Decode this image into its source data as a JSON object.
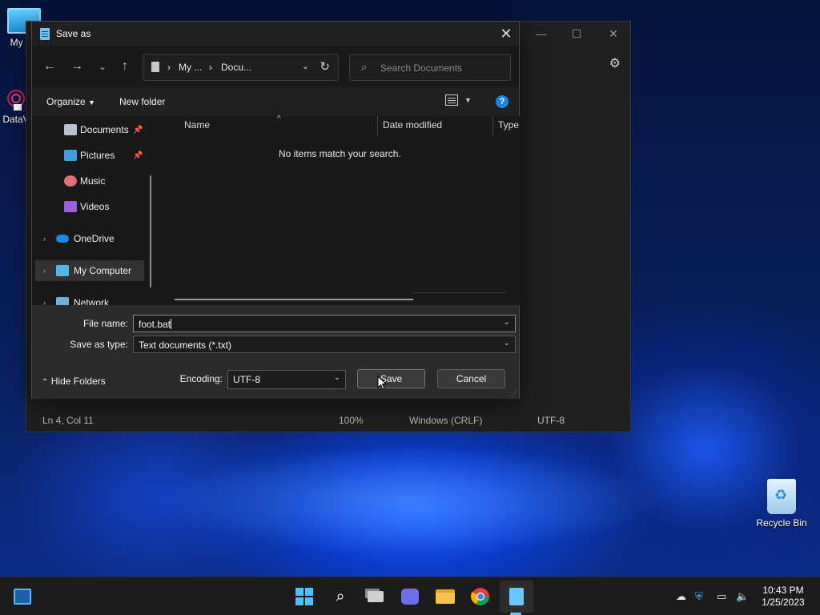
{
  "desktop": {
    "icons": [
      {
        "label": "My Co"
      },
      {
        "label": "DataV"
      },
      {
        "label": "Recycle Bin"
      }
    ]
  },
  "notepad": {
    "status": {
      "position": "Ln 4, Col 11",
      "zoom": "100%",
      "line_endings": "Windows (CRLF)",
      "encoding": "UTF-8"
    }
  },
  "dialog": {
    "title": "Save as",
    "address": {
      "crumb1": "My ...",
      "crumb2": "Docu..."
    },
    "search": {
      "placeholder": "Search Documents"
    },
    "commands": {
      "organize": "Organize",
      "new_folder": "New folder"
    },
    "sidebar": [
      {
        "label": "Documents",
        "pinned": true
      },
      {
        "label": "Pictures",
        "pinned": true
      },
      {
        "label": "Music"
      },
      {
        "label": "Videos"
      },
      {
        "label": "OneDrive"
      },
      {
        "label": "My Computer",
        "selected": true
      },
      {
        "label": "Network"
      }
    ],
    "columns": {
      "name": "Name",
      "date_modified": "Date modified",
      "type": "Type"
    },
    "empty_message": "No items match your search.",
    "file_name_label": "File name:",
    "file_name_value": "foot.bat",
    "save_type_label": "Save as type:",
    "save_type_value": "Text documents (*.txt)",
    "encoding_label": "Encoding:",
    "encoding_value": "UTF-8",
    "save_label": "Save",
    "cancel_label": "Cancel",
    "hide_folders_label": "Hide Folders"
  },
  "taskbar": {
    "time": "10:43 PM",
    "date": "1/25/2023"
  },
  "colors": {
    "accent": "#60cdff",
    "help_blue": "#1a82e2"
  }
}
